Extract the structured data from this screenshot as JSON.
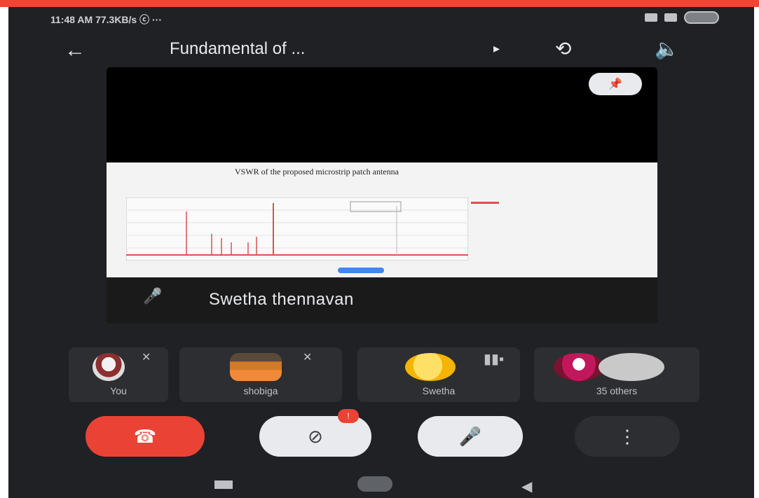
{
  "status": {
    "time_speed": "11:48 AM  77.3KB/s ⓒ ···"
  },
  "header": {
    "title": "Fundamental of ...",
    "back_icon": "←",
    "chevron_icon": "▸",
    "camera_switch_icon": "⟲",
    "speaker_icon": "🔈"
  },
  "stage": {
    "pin_icon": "📌",
    "slide_title": "VSWR of the proposed microstrip patch antenna",
    "speaker_name": "Swetha thennavan",
    "mic_off_icon": "🎤"
  },
  "tiles": [
    {
      "label": "You"
    },
    {
      "label": "shobiga"
    },
    {
      "label": "Swetha"
    },
    {
      "label": "35 others"
    }
  ],
  "controls": {
    "end_call_icon": "☎",
    "camera_off_icon": "⊘",
    "mic_off_icon": "🎤",
    "more_icon": "⋮",
    "badge": "!"
  },
  "nav": {
    "back_icon": "◀"
  },
  "colors": {
    "red": "#ea4335",
    "bg": "#202124",
    "tile": "#2d2e31"
  }
}
